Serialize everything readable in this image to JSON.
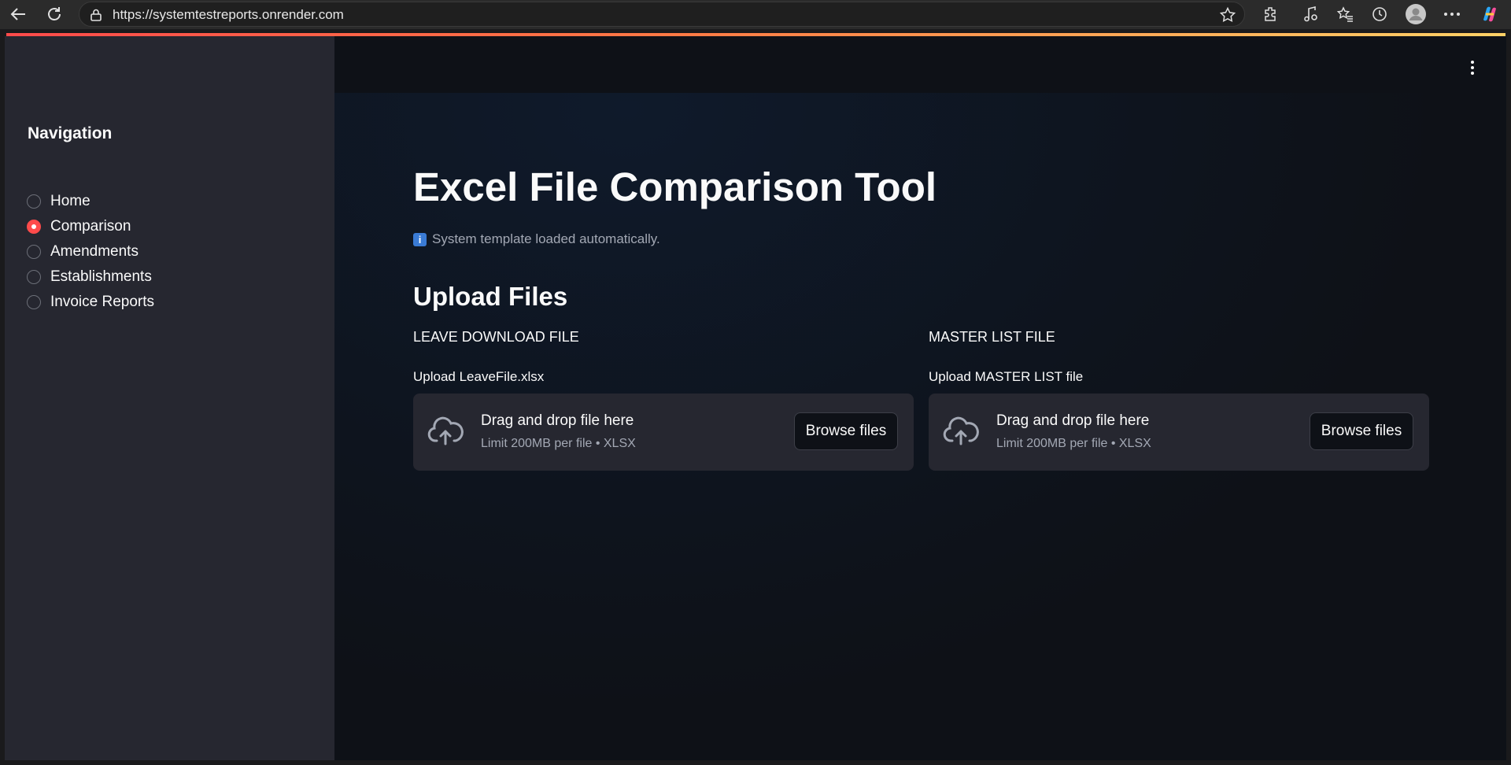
{
  "browser": {
    "url": "https://systemtestreports.onrender.com"
  },
  "sidebar": {
    "title": "Navigation",
    "items": [
      {
        "label": "Home",
        "checked": false
      },
      {
        "label": "Comparison",
        "checked": true
      },
      {
        "label": "Amendments",
        "checked": false
      },
      {
        "label": "Establishments",
        "checked": false
      },
      {
        "label": "Invoice Reports",
        "checked": false
      }
    ]
  },
  "main": {
    "title": "Excel File Comparison Tool",
    "info": {
      "icon": "info-icon",
      "text": "System template loaded automatically."
    },
    "upload_section_title": "Upload Files",
    "uploaders": [
      {
        "heading": "LEAVE DOWNLOAD FILE",
        "label": "Upload LeaveFile.xlsx",
        "drop_text": "Drag and drop file here",
        "limit_text": "Limit 200MB per file • XLSX",
        "button_label": "Browse files"
      },
      {
        "heading": "MASTER LIST FILE",
        "label": "Upload MASTER LIST file",
        "drop_text": "Drag and drop file here",
        "limit_text": "Limit 200MB per file • XLSX",
        "button_label": "Browse files"
      }
    ]
  },
  "colors": {
    "accent": "#ff4b4b",
    "sidebar_bg": "#262730",
    "main_bg": "#0e1117",
    "info_icon_bg": "#3a7bd5"
  }
}
